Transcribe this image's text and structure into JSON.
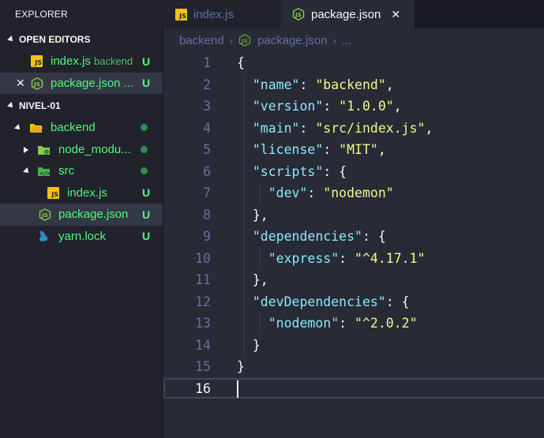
{
  "sidebar": {
    "title": "EXPLORER",
    "open_editors": {
      "label": "OPEN EDITORS",
      "items": [
        {
          "name": "index.js",
          "desc": "backend",
          "status": "U"
        },
        {
          "name": "package.json ...",
          "status": "U",
          "close": "✕"
        }
      ]
    },
    "workspace": {
      "label": "NIVEL-01",
      "tree": [
        {
          "name": "backend"
        },
        {
          "name": "node_modu..."
        },
        {
          "name": "src"
        },
        {
          "name": "index.js",
          "status": "U"
        },
        {
          "name": "package.json",
          "status": "U"
        },
        {
          "name": "yarn.lock",
          "status": "U"
        }
      ]
    }
  },
  "tabs": [
    {
      "label": "index.js",
      "icon": "js-icon"
    },
    {
      "label": "package.json",
      "icon": "node-icon",
      "close": "✕"
    }
  ],
  "breadcrumb": {
    "folder": "backend",
    "sep1": "›",
    "file": "package.json",
    "sep2": "›",
    "more": "..."
  },
  "editor": {
    "current_line": 16,
    "lines": [
      {
        "n": "1"
      },
      {
        "n": "2"
      },
      {
        "n": "3"
      },
      {
        "n": "4"
      },
      {
        "n": "5"
      },
      {
        "n": "6"
      },
      {
        "n": "7"
      },
      {
        "n": "8"
      },
      {
        "n": "9"
      },
      {
        "n": "10"
      },
      {
        "n": "11"
      },
      {
        "n": "12"
      },
      {
        "n": "13"
      },
      {
        "n": "14"
      },
      {
        "n": "15"
      },
      {
        "n": "16"
      }
    ],
    "tokens": {
      "l1": {
        "a": "{"
      },
      "l2": {
        "k": "\"name\"",
        "c": ": ",
        "v": "\"backend\"",
        "e": ","
      },
      "l3": {
        "k": "\"version\"",
        "c": ": ",
        "v": "\"1.0.0\"",
        "e": ","
      },
      "l4": {
        "k": "\"main\"",
        "c": ": ",
        "v": "\"src/index.js\"",
        "e": ","
      },
      "l5": {
        "k": "\"license\"",
        "c": ": ",
        "v": "\"MIT\"",
        "e": ","
      },
      "l6": {
        "k": "\"scripts\"",
        "c": ": ",
        "e": "{"
      },
      "l7": {
        "k": "\"dev\"",
        "c": ": ",
        "v": "\"nodemon\""
      },
      "l8": {
        "a": "},"
      },
      "l9": {
        "k": "\"dependencies\"",
        "c": ": ",
        "e": "{"
      },
      "l10": {
        "k": "\"express\"",
        "c": ": ",
        "v": "\"^4.17.1\""
      },
      "l11": {
        "a": "},"
      },
      "l12": {
        "k": "\"devDependencies\"",
        "c": ": ",
        "e": "{"
      },
      "l13": {
        "k": "\"nodemon\"",
        "c": ": ",
        "v": "\"^2.0.2\""
      },
      "l14": {
        "a": "}"
      },
      "l15": {
        "a": "}"
      }
    }
  },
  "colors": {
    "background": "#282a36",
    "sidebar": "#21222c",
    "untracked_green": "#50fa7b",
    "json_key": "#8be9fd",
    "json_string": "#f1fa8c",
    "line_number": "#6272a4"
  }
}
